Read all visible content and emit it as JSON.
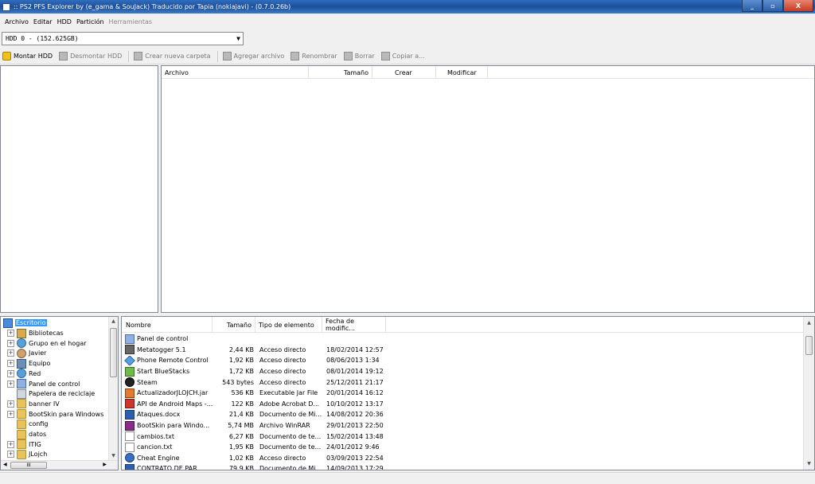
{
  "window": {
    "title": ":: PS2 PFS Explorer by (e_gama & SouJack) Traducido por Tapia (nokiajavi) - (0.7.0.26b)",
    "minimize": "_",
    "maximize": "▫",
    "close": "X"
  },
  "menu": [
    "Archivo",
    "Editar",
    "HDD",
    "Partición",
    "Herramientas"
  ],
  "drive_select": {
    "value": "HDD 0 - (152.625GB)"
  },
  "toolbar": {
    "mount": "Montar HDD",
    "unmount": "Desmontar HDD",
    "new_folder": "Crear nueva carpeta",
    "add_file": "Agregar archivo",
    "rename": "Renombrar",
    "delete": "Borrar",
    "copy": "Copiar a..."
  },
  "hdd_files": {
    "columns": [
      "Archivo",
      "Tamaño",
      "Crear",
      "Modificar"
    ]
  },
  "tree": {
    "selected": "Escritorio",
    "items": [
      {
        "label": "Bibliotecas",
        "icon": "library-icon"
      },
      {
        "label": "Grupo en el hogar",
        "icon": "homegroup-icon"
      },
      {
        "label": "Javier",
        "icon": "user-icon"
      },
      {
        "label": "Equipo",
        "icon": "computer-icon"
      },
      {
        "label": "Red",
        "icon": "network-icon"
      },
      {
        "label": "Panel de control",
        "icon": "control-panel-icon"
      },
      {
        "label": "Papelera de reciclaje",
        "icon": "recycle-bin-icon"
      },
      {
        "label": "banner IV",
        "icon": "folder-icon"
      },
      {
        "label": "BootSkin para  Windows",
        "icon": "folder-icon"
      },
      {
        "label": "config",
        "icon": "folder-icon"
      },
      {
        "label": "datos",
        "icon": "folder-icon"
      },
      {
        "label": "ITIG",
        "icon": "folder-icon"
      },
      {
        "label": "JLojch",
        "icon": "folder-icon"
      }
    ]
  },
  "local_files": {
    "columns": [
      "Nombre",
      "Tamaño",
      "Tipo de elemento",
      "Fecha de modific..."
    ],
    "rows": [
      {
        "name": "Panel de control",
        "size": "",
        "type": "",
        "date": "",
        "icon": "control-panel-icon"
      },
      {
        "name": "Metatogger 5.1",
        "size": "2,44 KB",
        "type": "Acceso directo",
        "date": "18/02/2014 12:57",
        "icon": "shortcut-icon"
      },
      {
        "name": "Phone Remote Control",
        "size": "1,92 KB",
        "type": "Acceso directo",
        "date": "08/06/2013 1:34",
        "icon": "star-icon"
      },
      {
        "name": "Start BlueStacks",
        "size": "1,72 KB",
        "type": "Acceso directo",
        "date": "08/01/2014 19:12",
        "icon": "bluestacks-icon"
      },
      {
        "name": "Steam",
        "size": "543 bytes",
        "type": "Acceso directo",
        "date": "25/12/2011 21:17",
        "icon": "steam-icon"
      },
      {
        "name": "ActualizadorJLOJCH.jar",
        "size": "536 KB",
        "type": "Executable Jar File",
        "date": "20/01/2014 16:12",
        "icon": "jar-icon"
      },
      {
        "name": "API de Android Maps -...",
        "size": "122 KB",
        "type": "Adobe Acrobat D...",
        "date": "10/10/2012 13:17",
        "icon": "pdf-icon"
      },
      {
        "name": "Ataques.docx",
        "size": "21,4 KB",
        "type": "Documento de Mi...",
        "date": "14/08/2012 20:36",
        "icon": "word-icon"
      },
      {
        "name": "BootSkin para  Windo...",
        "size": "5,74 MB",
        "type": "Archivo WinRAR",
        "date": "29/01/2013 22:50",
        "icon": "rar-icon"
      },
      {
        "name": "cambios.txt",
        "size": "6,27 KB",
        "type": "Documento de te...",
        "date": "15/02/2014 13:48",
        "icon": "text-file-icon"
      },
      {
        "name": "cancion.txt",
        "size": "1,95 KB",
        "type": "Documento de te...",
        "date": "24/01/2012 9:46",
        "icon": "text-file-icon"
      },
      {
        "name": "Cheat Engine",
        "size": "1,02 KB",
        "type": "Acceso directo",
        "date": "03/09/2013 22:54",
        "icon": "cheat-engine-icon"
      },
      {
        "name": "CONTRATO DE PAR...",
        "size": "79,9 KB",
        "type": "Documento de Mi...",
        "date": "14/09/2013 17:29",
        "icon": "word-icon"
      }
    ]
  },
  "tree_hscroll_label": "III"
}
